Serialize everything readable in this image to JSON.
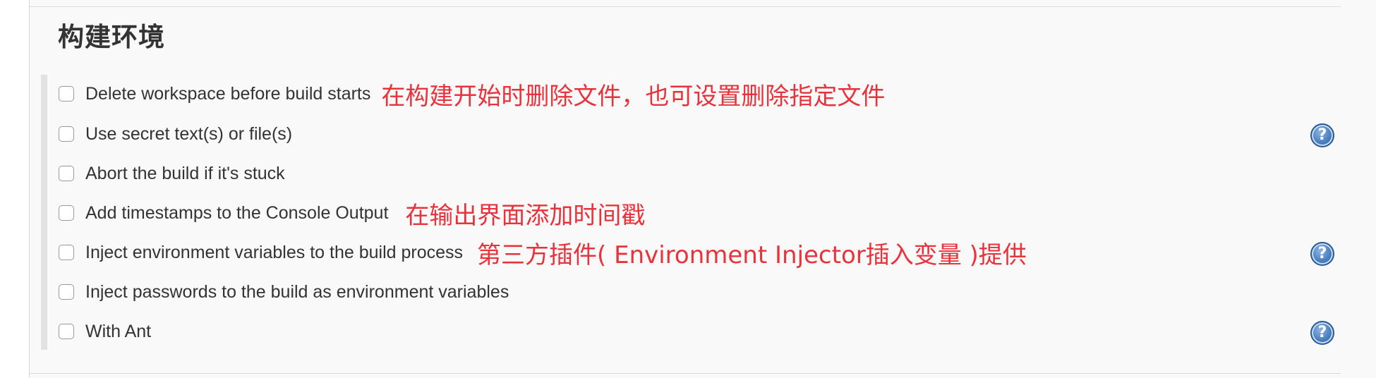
{
  "section": {
    "title": "构建环境"
  },
  "options": [
    {
      "label": "Delete workspace before build starts",
      "checked": false,
      "annotation": "在构建开始时删除文件，也可设置删除指定文件",
      "has_help": false
    },
    {
      "label": "Use secret text(s) or file(s)",
      "checked": false,
      "annotation": "",
      "has_help": true
    },
    {
      "label": "Abort the build if it's stuck",
      "checked": false,
      "annotation": "",
      "has_help": false
    },
    {
      "label": "Add timestamps to the Console Output",
      "checked": false,
      "annotation": "在输出界面添加时间戳",
      "has_help": false
    },
    {
      "label": "Inject environment variables to the build process",
      "checked": false,
      "annotation": "第三方插件( Environment Injector插入变量 )提供",
      "has_help": true
    },
    {
      "label": "Inject passwords to the build as environment variables",
      "checked": false,
      "annotation": "",
      "has_help": false
    },
    {
      "label": "With Ant",
      "checked": false,
      "annotation": "",
      "has_help": true
    }
  ],
  "help_icon": {
    "glyph": "?",
    "icon": "help-icon"
  },
  "colors": {
    "annotation": "#e8323c",
    "text": "#333333",
    "panel_bg": "#f9f9f9",
    "help_blue": "#4a7fc0"
  }
}
